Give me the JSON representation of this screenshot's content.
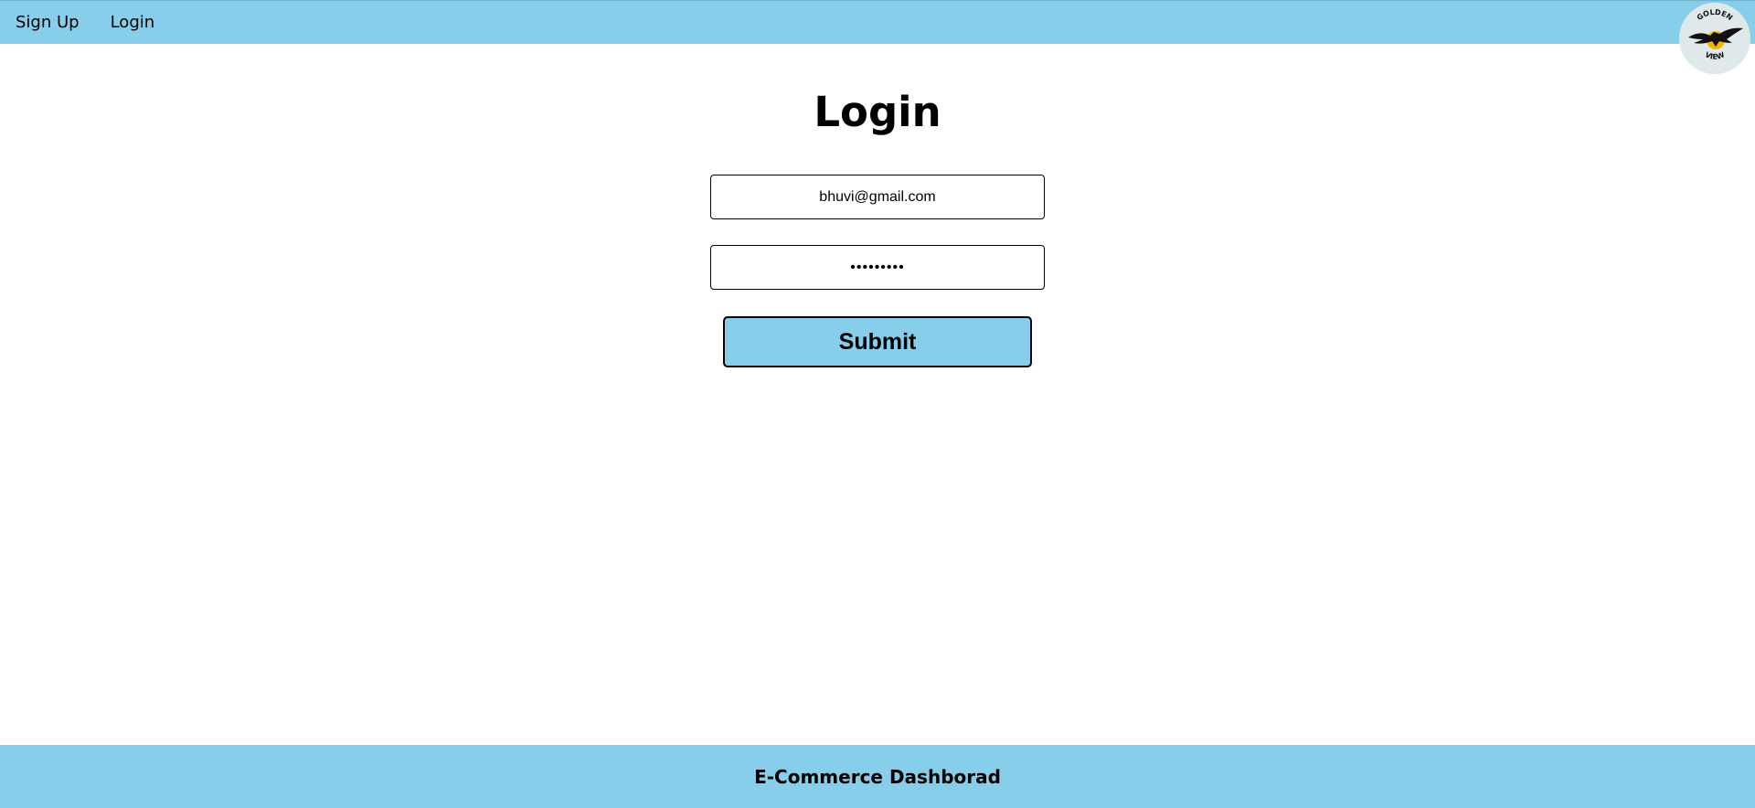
{
  "nav": {
    "links": [
      {
        "label": "Sign Up"
      },
      {
        "label": "Login"
      }
    ],
    "logo": {
      "text_top": "GOLDEN",
      "text_bottom": "VIEW",
      "icon": "eagle-logo-icon",
      "colors": {
        "background": "#dfe9eb",
        "sun": "#f5b400",
        "bird": "#111111"
      }
    }
  },
  "form": {
    "title": "Login",
    "email_value": "bhuvi@gmail.com",
    "password_value": "•••••••••",
    "submit_label": "Submit"
  },
  "footer": {
    "text": "E-Commerce Dashborad"
  },
  "colors": {
    "accent": "#87ceeb",
    "text": "#000000",
    "background": "#ffffff"
  }
}
